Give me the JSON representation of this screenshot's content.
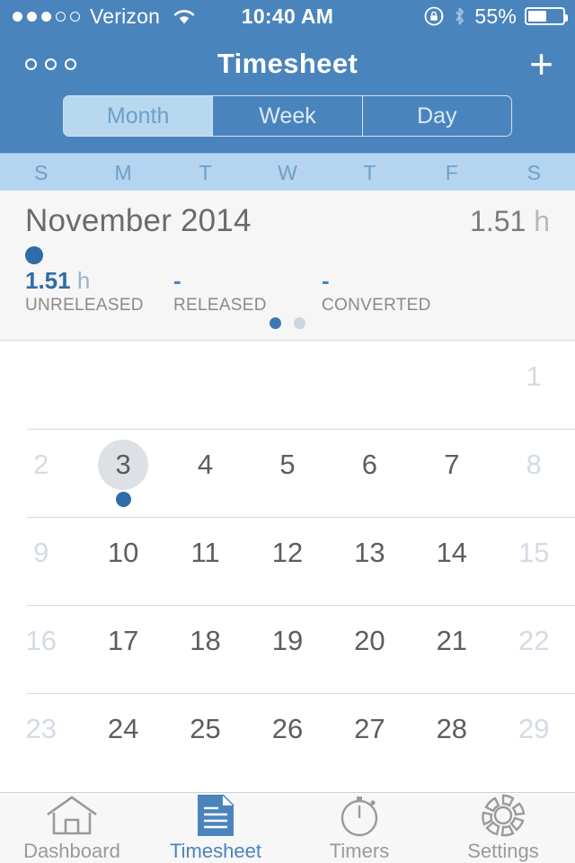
{
  "status_bar": {
    "carrier": "Verizon",
    "signal_dots_filled": 3,
    "signal_dots_total": 5,
    "time": "10:40 AM",
    "battery_percent": "55%",
    "battery_level": 55,
    "icons": [
      "wifi-icon",
      "rotation-lock-icon",
      "bluetooth-icon",
      "battery-icon"
    ]
  },
  "nav_bar": {
    "title": "Timesheet",
    "menu_icon": "three-circles-menu-icon",
    "add_icon": "plus-icon"
  },
  "segmented_control": {
    "options": [
      {
        "label": "Month",
        "selected": true
      },
      {
        "label": "Week",
        "selected": false
      },
      {
        "label": "Day",
        "selected": false
      }
    ]
  },
  "weekday_header": [
    "S",
    "M",
    "T",
    "W",
    "T",
    "F",
    "S"
  ],
  "summary": {
    "month_title": "November 2014",
    "total_value": "1.51",
    "total_unit": "h",
    "legend_dot_color": "#2f6ca8",
    "stats": [
      {
        "value": "1.51",
        "unit": "h",
        "label": "UNRELEASED"
      },
      {
        "value": "-",
        "unit": "",
        "label": "RELEASED"
      },
      {
        "value": "-",
        "unit": "",
        "label": "CONVERTED"
      }
    ],
    "page_indicator": {
      "total": 2,
      "active_index": 0
    }
  },
  "calendar": {
    "rows": [
      [
        {
          "day": "",
          "dim": true,
          "selected": false,
          "event": false
        },
        {
          "day": "",
          "dim": true,
          "selected": false,
          "event": false
        },
        {
          "day": "",
          "dim": true,
          "selected": false,
          "event": false
        },
        {
          "day": "",
          "dim": true,
          "selected": false,
          "event": false
        },
        {
          "day": "",
          "dim": true,
          "selected": false,
          "event": false
        },
        {
          "day": "",
          "dim": true,
          "selected": false,
          "event": false
        },
        {
          "day": "1",
          "dim": true,
          "selected": false,
          "event": false
        }
      ],
      [
        {
          "day": "2",
          "dim": true,
          "selected": false,
          "event": false
        },
        {
          "day": "3",
          "dim": false,
          "selected": true,
          "event": true
        },
        {
          "day": "4",
          "dim": false,
          "selected": false,
          "event": false
        },
        {
          "day": "5",
          "dim": false,
          "selected": false,
          "event": false
        },
        {
          "day": "6",
          "dim": false,
          "selected": false,
          "event": false
        },
        {
          "day": "7",
          "dim": false,
          "selected": false,
          "event": false
        },
        {
          "day": "8",
          "dim": true,
          "selected": false,
          "event": false
        }
      ],
      [
        {
          "day": "9",
          "dim": true,
          "selected": false,
          "event": false
        },
        {
          "day": "10",
          "dim": false,
          "selected": false,
          "event": false
        },
        {
          "day": "11",
          "dim": false,
          "selected": false,
          "event": false
        },
        {
          "day": "12",
          "dim": false,
          "selected": false,
          "event": false
        },
        {
          "day": "13",
          "dim": false,
          "selected": false,
          "event": false
        },
        {
          "day": "14",
          "dim": false,
          "selected": false,
          "event": false
        },
        {
          "day": "15",
          "dim": true,
          "selected": false,
          "event": false
        }
      ],
      [
        {
          "day": "16",
          "dim": true,
          "selected": false,
          "event": false
        },
        {
          "day": "17",
          "dim": false,
          "selected": false,
          "event": false
        },
        {
          "day": "18",
          "dim": false,
          "selected": false,
          "event": false
        },
        {
          "day": "19",
          "dim": false,
          "selected": false,
          "event": false
        },
        {
          "day": "20",
          "dim": false,
          "selected": false,
          "event": false
        },
        {
          "day": "21",
          "dim": false,
          "selected": false,
          "event": false
        },
        {
          "day": "22",
          "dim": true,
          "selected": false,
          "event": false
        }
      ],
      [
        {
          "day": "23",
          "dim": true,
          "selected": false,
          "event": false
        },
        {
          "day": "24",
          "dim": false,
          "selected": false,
          "event": false
        },
        {
          "day": "25",
          "dim": false,
          "selected": false,
          "event": false
        },
        {
          "day": "26",
          "dim": false,
          "selected": false,
          "event": false
        },
        {
          "day": "27",
          "dim": false,
          "selected": false,
          "event": false
        },
        {
          "day": "28",
          "dim": false,
          "selected": false,
          "event": false
        },
        {
          "day": "29",
          "dim": true,
          "selected": false,
          "event": false
        }
      ]
    ]
  },
  "tab_bar": {
    "tabs": [
      {
        "label": "Dashboard",
        "icon": "home-icon",
        "active": false
      },
      {
        "label": "Timesheet",
        "icon": "document-icon",
        "active": true
      },
      {
        "label": "Timers",
        "icon": "stopwatch-icon",
        "active": false
      },
      {
        "label": "Settings",
        "icon": "gear-icon",
        "active": false
      }
    ]
  },
  "colors": {
    "brand_blue": "#4a84bd",
    "accent_blue": "#2f6ca8",
    "header_light_blue": "#b4d4ef",
    "selected_segment": "#b8d8f0",
    "selected_day_circle": "#dde1e6",
    "summary_bg": "#f6f6f6",
    "tabbar_bg": "#f7f7f7"
  }
}
